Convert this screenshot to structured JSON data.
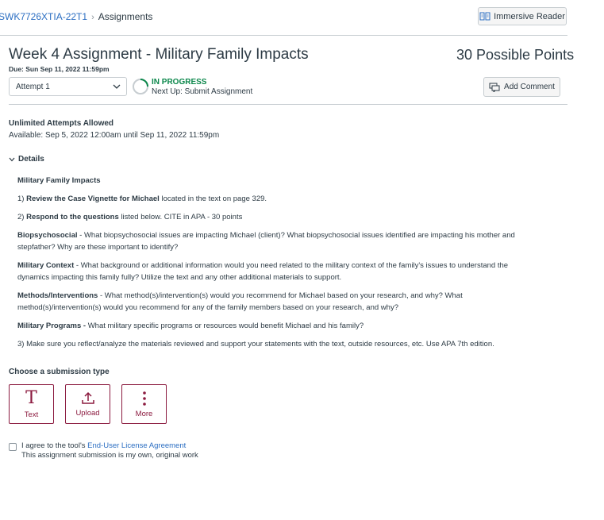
{
  "breadcrumb": {
    "course": "SWK7726XTIA-22T1",
    "separator": "›",
    "current": "Assignments"
  },
  "toolbar": {
    "immersive_reader_label": "Immersive Reader"
  },
  "assignment": {
    "title": "Week 4 Assignment - Military Family Impacts",
    "points": "30 Possible Points",
    "due": "Due: Sun Sep 11, 2022 11:59pm",
    "attempt_selected": "Attempt 1",
    "status_title": "IN PROGRESS",
    "status_next": "Next Up: Submit Assignment",
    "add_comment_label": "Add Comment",
    "attempts_allowed": "Unlimited Attempts Allowed",
    "available": "Available: Sep 5, 2022 12:00am until Sep 11, 2022 11:59pm",
    "details_label": "Details"
  },
  "description": {
    "heading": "Military Family Impacts",
    "step1_bold": "Review the Case Vignette for Michael",
    "step1_prefix": "1) ",
    "step1_rest": " located in the text on page 329.",
    "step2_prefix": "2) ",
    "step2_bold": "Respond to the questions",
    "step2_rest": " listed below. CITE in APA - 30 points",
    "q1_bold": "Biopsychosocial",
    "q1_rest": " - What biopsychosocial issues are impacting Michael (client)? What biopsychosocial issues identified are impacting his mother and stepfather? Why are these important to identify?",
    "q2_bold": "Military Context",
    "q2_rest": " - What background or additional information would you need related to the military context of the family's issues to understand the dynamics impacting this family fully? Utilize the text and any other additional materials to support.",
    "q3_bold": "Methods/Interventions",
    "q3_rest": " - What method(s)/intervention(s) would you recommend for Michael based on your research, and why? What method(s)/intervention(s) would you recommend for any of the family members based on your research, and why?",
    "q4_bold": "Military Programs -",
    "q4_rest": " What military specific programs or resources would benefit Michael and his family?",
    "step3": "3) Make sure you reflect/analyze the materials reviewed and support your statements with the text, outside resources, etc. Use APA 7th edition."
  },
  "submission": {
    "heading": "Choose a submission type",
    "text_glyph": "T",
    "text_label": "Text",
    "upload_label": "Upload",
    "more_label": "More"
  },
  "agreement": {
    "prefix": "I agree to the tool's ",
    "link": "End-User License Agreement",
    "statement": "This assignment submission is my own, original work"
  },
  "colors": {
    "link": "#2b6ec2",
    "success": "#0b874b",
    "brand": "#8b1a3f",
    "text": "#2d3b45"
  }
}
